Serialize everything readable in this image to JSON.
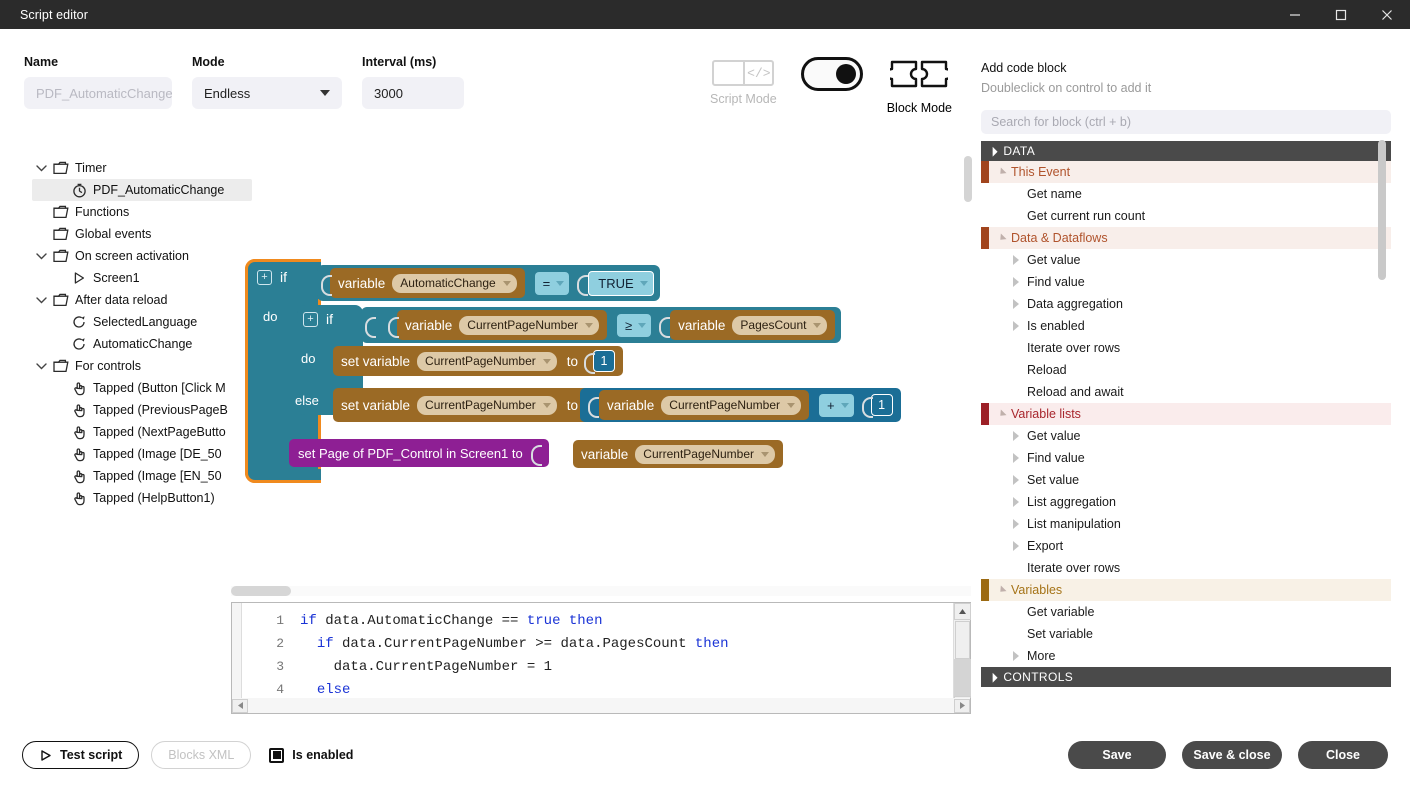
{
  "window": {
    "title": "Script editor",
    "controls": [
      {
        "name": "minimize-button",
        "glyph": "minimize"
      },
      {
        "name": "maximize-button",
        "glyph": "maximize"
      },
      {
        "name": "close-button",
        "glyph": "close"
      }
    ]
  },
  "form": {
    "name": {
      "label": "Name",
      "value": "",
      "placeholder": "PDF_AutomaticChange"
    },
    "mode": {
      "label": "Mode",
      "value": "Endless"
    },
    "interval": {
      "label": "Interval (ms)",
      "value": "3000"
    }
  },
  "mode_switch": {
    "script_label": "Script Mode",
    "script_icon": "code-brackets-icon",
    "block_label": "Block Mode",
    "block_icon": "puzzle-pieces-icon",
    "active": "Block Mode",
    "toggle_state": "on"
  },
  "tree": {
    "items": [
      {
        "label": "Timer",
        "icon": "folder-icon",
        "depth": 0,
        "twisty": "down",
        "selected": false
      },
      {
        "label": "PDF_AutomaticChange",
        "icon": "timer-icon",
        "depth": 1,
        "twisty": "none",
        "selected": true
      },
      {
        "label": "Functions",
        "icon": "folder-icon",
        "depth": 0,
        "twisty": "none",
        "selected": false
      },
      {
        "label": "Global events",
        "icon": "folder-icon",
        "depth": 0,
        "twisty": "none",
        "selected": false
      },
      {
        "label": "On screen activation",
        "icon": "folder-icon",
        "depth": 0,
        "twisty": "down",
        "selected": false
      },
      {
        "label": "Screen1",
        "icon": "play-triangle-icon",
        "depth": 1,
        "twisty": "none",
        "selected": false
      },
      {
        "label": "After data reload",
        "icon": "folder-icon",
        "depth": 0,
        "twisty": "down",
        "selected": false
      },
      {
        "label": "SelectedLanguage",
        "icon": "reload-icon",
        "depth": 1,
        "twisty": "none",
        "selected": false
      },
      {
        "label": "AutomaticChange",
        "icon": "reload-icon",
        "depth": 1,
        "twisty": "none",
        "selected": false
      },
      {
        "label": "For controls",
        "icon": "folder-icon",
        "depth": 0,
        "twisty": "down",
        "selected": false
      },
      {
        "label": "Tapped (Button [Click M",
        "icon": "tap-hand-icon",
        "depth": 1,
        "twisty": "none",
        "selected": false
      },
      {
        "label": "Tapped (PreviousPageB",
        "icon": "tap-hand-icon",
        "depth": 1,
        "twisty": "none",
        "selected": false
      },
      {
        "label": "Tapped (NextPageButto",
        "icon": "tap-hand-icon",
        "depth": 1,
        "twisty": "none",
        "selected": false
      },
      {
        "label": "Tapped (Image [DE_50",
        "icon": "tap-hand-icon",
        "depth": 1,
        "twisty": "none",
        "selected": false
      },
      {
        "label": "Tapped (Image [EN_50",
        "icon": "tap-hand-icon",
        "depth": 1,
        "twisty": "none",
        "selected": false
      },
      {
        "label": "Tapped (HelpButton1)",
        "icon": "tap-hand-icon",
        "depth": 1,
        "twisty": "none",
        "selected": false
      }
    ]
  },
  "blocks": {
    "if_outer": {
      "keyword": "if",
      "do_label": "do",
      "plus": "+"
    },
    "cond_outer": {
      "variable_label": "variable",
      "variable_name": "AutomaticChange",
      "operator": "=",
      "value": "TRUE"
    },
    "if_inner": {
      "keyword": "if",
      "do_label": "do",
      "else_label": "else",
      "plus": "+"
    },
    "cond_inner": {
      "left_label": "variable",
      "left_name": "CurrentPageNumber",
      "operator": "≥",
      "right_label": "variable",
      "right_name": "PagesCount"
    },
    "do_stmt": {
      "set_label": "set variable",
      "target": "CurrentPageNumber",
      "to_label": "to",
      "value": "1"
    },
    "else_stmt": {
      "set_label": "set variable",
      "target": "CurrentPageNumber",
      "to_label": "to",
      "operand_label": "variable",
      "operand_name": "CurrentPageNumber",
      "operator": "+",
      "addend": "1"
    },
    "final_stmt": {
      "text": "set Page of PDF_Control in Screen1 to",
      "variable_label": "variable",
      "variable_name": "CurrentPageNumber"
    },
    "trash_icon": "trash-can-icon"
  },
  "code": {
    "lines": [
      {
        "num": "1",
        "parts": [
          {
            "t": "if ",
            "k": true
          },
          {
            "t": "data.AutomaticChange == ",
            "k": false
          },
          {
            "t": "true then",
            "k": true
          }
        ],
        "indent": 0
      },
      {
        "num": "2",
        "parts": [
          {
            "t": "if ",
            "k": true
          },
          {
            "t": "data.CurrentPageNumber >= data.PagesCount ",
            "k": false
          },
          {
            "t": "then",
            "k": true
          }
        ],
        "indent": 1
      },
      {
        "num": "3",
        "parts": [
          {
            "t": "data.CurrentPageNumber = 1",
            "k": false
          }
        ],
        "indent": 2
      },
      {
        "num": "4",
        "parts": [
          {
            "t": "else",
            "k": true
          }
        ],
        "indent": 1
      }
    ]
  },
  "palette": {
    "title": "Add code block",
    "subtitle": "Doubleclick on control to add it",
    "search_placeholder": "Search for block (ctrl + b)",
    "groups": [
      {
        "type": "group",
        "label": "DATA",
        "expanded": true,
        "children": [
          {
            "type": "sub",
            "label": "This Event",
            "color": "#a1441d",
            "bg": "#f8eeea",
            "text": "#b0532c"
          },
          {
            "type": "leaf",
            "label": "Get name",
            "expandable": false
          },
          {
            "type": "leaf",
            "label": "Get current run count",
            "expandable": false
          },
          {
            "type": "sub",
            "label": "Data & Dataflows",
            "color": "#a1441d",
            "bg": "#f8eeea",
            "text": "#b0532c"
          },
          {
            "type": "leaf",
            "label": "Get value",
            "expandable": true
          },
          {
            "type": "leaf",
            "label": "Find value",
            "expandable": true
          },
          {
            "type": "leaf",
            "label": "Data aggregation",
            "expandable": true
          },
          {
            "type": "leaf",
            "label": "Is enabled",
            "expandable": true
          },
          {
            "type": "leaf",
            "label": "Iterate over rows",
            "expandable": false
          },
          {
            "type": "leaf",
            "label": "Reload",
            "expandable": false
          },
          {
            "type": "leaf",
            "label": "Reload and await",
            "expandable": false
          },
          {
            "type": "sub",
            "label": "Variable lists",
            "color": "#9c1f26",
            "bg": "#faecec",
            "text": "#a8262d"
          },
          {
            "type": "leaf",
            "label": "Get value",
            "expandable": true
          },
          {
            "type": "leaf",
            "label": "Find value",
            "expandable": true
          },
          {
            "type": "leaf",
            "label": "Set value",
            "expandable": true
          },
          {
            "type": "leaf",
            "label": "List aggregation",
            "expandable": true
          },
          {
            "type": "leaf",
            "label": "List manipulation",
            "expandable": true
          },
          {
            "type": "leaf",
            "label": "Export",
            "expandable": true
          },
          {
            "type": "leaf",
            "label": "Iterate over rows",
            "expandable": false
          },
          {
            "type": "sub",
            "label": "Variables",
            "color": "#9c6a12",
            "bg": "#f8f1e6",
            "text": "#a57317"
          },
          {
            "type": "leaf",
            "label": "Get variable",
            "expandable": false
          },
          {
            "type": "leaf",
            "label": "Set variable",
            "expandable": false
          },
          {
            "type": "leaf",
            "label": "More",
            "expandable": true
          }
        ]
      },
      {
        "type": "group",
        "label": "CONTROLS",
        "expanded": true,
        "children": []
      }
    ]
  },
  "footer": {
    "test_script": "Test script",
    "test_script_icon": "play-icon",
    "blocks_xml": "Blocks XML",
    "is_enabled_label": "Is enabled",
    "is_enabled_checked": true,
    "save": "Save",
    "save_close": "Save & close",
    "close": "Close"
  },
  "colors": {
    "titlebar": "#2b2b2b",
    "accent_orange": "#f08a1e",
    "block_control": "#2b7f95",
    "block_variable": "#9b6a25",
    "block_math": "#1b6e96",
    "block_logic": "#8fcfdf",
    "block_component": "#8e1f94",
    "group_header": "#4a4a4a",
    "dark_button": "#4a4a4a"
  }
}
